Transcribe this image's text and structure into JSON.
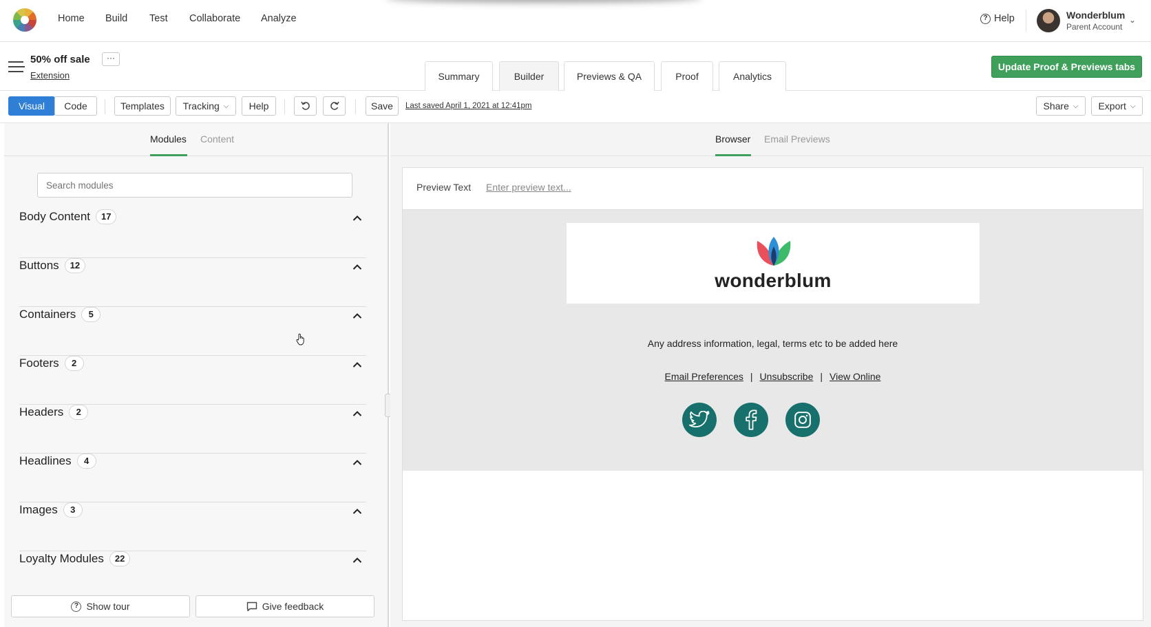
{
  "topnav": {
    "nav_items": [
      "Home",
      "Build",
      "Test",
      "Collaborate",
      "Analyze"
    ],
    "help_label": "Help",
    "account_name": "Wonderblum",
    "account_sub": "Parent Account"
  },
  "subheader": {
    "title": "50% off sale",
    "link": "Extension",
    "more_label": "···",
    "tabs": [
      "Summary",
      "Builder",
      "Previews & QA",
      "Proof",
      "Analytics"
    ],
    "active_tab": "Builder",
    "update_button": "Update Proof & Previews tabs"
  },
  "toolbar": {
    "visual": "Visual",
    "code": "Code",
    "templates": "Templates",
    "tracking": "Tracking",
    "help": "Help",
    "save": "Save",
    "last_saved": "Last saved April 1, 2021 at 12:41pm",
    "share": "Share",
    "export": "Export"
  },
  "left_panel": {
    "tabs": [
      "Modules",
      "Content"
    ],
    "active_tab": "Modules",
    "search_placeholder": "Search modules",
    "sections": [
      {
        "label": "Body Content",
        "count": "17"
      },
      {
        "label": "Buttons",
        "count": "12"
      },
      {
        "label": "Containers",
        "count": "5"
      },
      {
        "label": "Footers",
        "count": "2"
      },
      {
        "label": "Headers",
        "count": "2"
      },
      {
        "label": "Headlines",
        "count": "4"
      },
      {
        "label": "Images",
        "count": "3"
      },
      {
        "label": "Loyalty Modules",
        "count": "22"
      }
    ],
    "show_tour": "Show tour",
    "give_feedback": "Give feedback"
  },
  "right_panel": {
    "tabs": [
      "Browser",
      "Email Previews"
    ],
    "active_tab": "Browser",
    "preview_text_label": "Preview Text",
    "preview_text_placeholder": "Enter preview text...",
    "email": {
      "brand": "wonderblum",
      "address": "Any address information, legal, terms etc to be added here",
      "links": [
        "Email Preferences",
        "Unsubscribe",
        "View Online"
      ],
      "social": [
        "twitter-icon",
        "facebook-icon",
        "instagram-icon"
      ]
    }
  },
  "colors": {
    "primary_blue": "#2f7fd6",
    "accent_green": "#3ea05a",
    "social_teal": "#17706b"
  }
}
